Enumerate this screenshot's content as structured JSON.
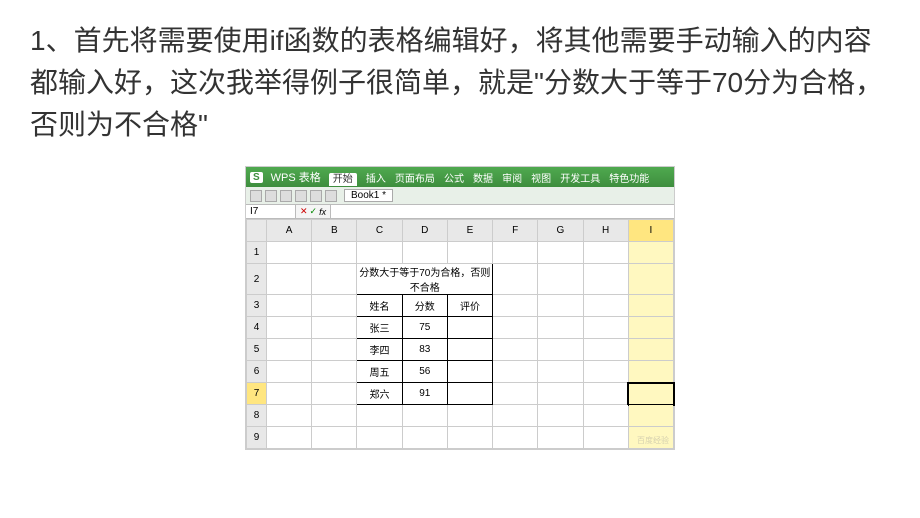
{
  "instruction": "1、首先将需要使用if函数的表格编辑好，将其他需要手动输入的内容都输入好，这次我举得例子很简单，就是\"分数大于等于70分为合格，否则为不合格\"",
  "wps": {
    "app_label": "WPS 表格",
    "tabs": [
      "开始",
      "插入",
      "页面布局",
      "公式",
      "数据",
      "审阅",
      "视图",
      "开发工具",
      "特色功能"
    ],
    "doc_tab": "Book1 *"
  },
  "formula": {
    "name_box": "I7",
    "cancel": "✕",
    "enter": "✓",
    "fx": "fx",
    "input": ""
  },
  "columns": [
    "A",
    "B",
    "C",
    "D",
    "E",
    "F",
    "G",
    "H",
    "I"
  ],
  "rows": [
    "1",
    "2",
    "3",
    "4",
    "5",
    "6",
    "7",
    "8",
    "9"
  ],
  "table": {
    "title": "分数大于等于70为合格，否则不合格",
    "headers": [
      "姓名",
      "分数",
      "评价"
    ],
    "data": [
      {
        "name": "张三",
        "score": "75",
        "eval": ""
      },
      {
        "name": "李四",
        "score": "83",
        "eval": ""
      },
      {
        "name": "周五",
        "score": "56",
        "eval": ""
      },
      {
        "name": "郑六",
        "score": "91",
        "eval": ""
      }
    ]
  },
  "watermark": "百度经验"
}
